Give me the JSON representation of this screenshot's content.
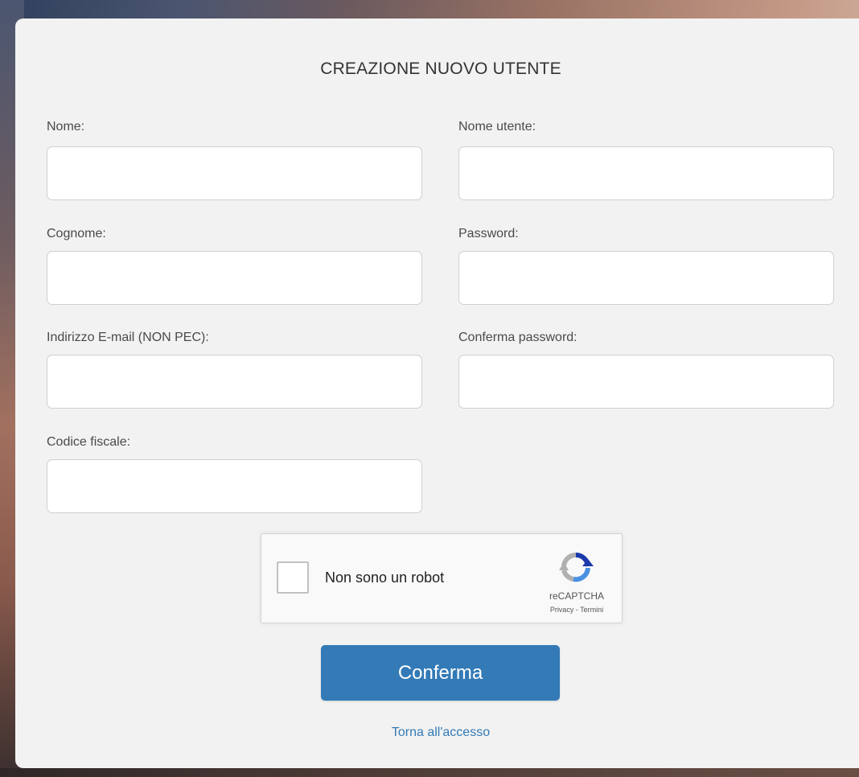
{
  "form": {
    "title": "CREAZIONE NUOVO UTENTE",
    "fields": {
      "nome": {
        "label": "Nome:",
        "value": ""
      },
      "cognome": {
        "label": "Cognome:",
        "value": ""
      },
      "email": {
        "label": "Indirizzo E-mail (NON PEC):",
        "value": ""
      },
      "codice_fiscale": {
        "label": "Codice fiscale:",
        "value": ""
      },
      "nome_utente": {
        "label": "Nome utente:",
        "value": ""
      },
      "password": {
        "label": "Password:",
        "value": ""
      },
      "conferma_password": {
        "label": "Conferma password:",
        "value": ""
      }
    }
  },
  "recaptcha": {
    "label": "Non sono un robot",
    "brand": "reCAPTCHA",
    "privacy_link": "Privacy",
    "separator": " - ",
    "terms_link": "Termini",
    "checked": false,
    "icon": "recaptcha-logo-icon",
    "colors": {
      "blue": "#1c3aa9",
      "light_blue": "#4a90e2",
      "gray": "#b0b0b0"
    }
  },
  "actions": {
    "confirm_label": "Conferma",
    "back_label": "Torna all'accesso"
  },
  "colors": {
    "accent": "#337ab7",
    "card_background": "#f2f2f2"
  }
}
